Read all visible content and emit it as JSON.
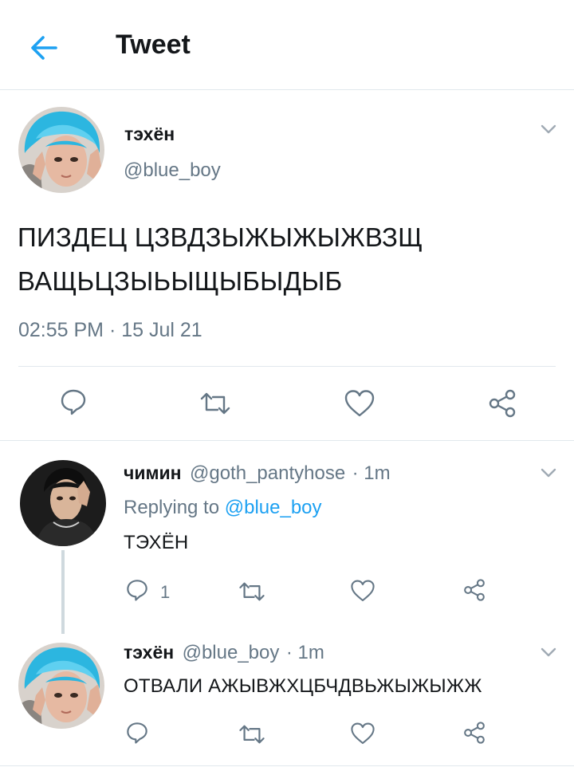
{
  "header": {
    "title": "Tweet"
  },
  "main_tweet": {
    "name": "тэхён",
    "handle": "@blue_boy",
    "text_line1": "ПИЗДЕЦ ЦЗВДЗЫЖЫЖЫЖВЗЩ",
    "text_line2": "ВАЩЬЦЗЫЬЫЩЫБЫДЫБ",
    "timestamp": "02:55 PM · 15 Jul 21"
  },
  "replies": [
    {
      "name": "чимин",
      "handle": "@goth_pantyhose",
      "time": "· 1m",
      "replying_prefix": "Replying to",
      "replying_to": "@blue_boy",
      "text": "ТЭХЁН",
      "reply_count": "1"
    },
    {
      "name": "тэхён",
      "handle": "@blue_boy",
      "time": "· 1m",
      "text": "ОТВАЛИ АЖЫВЖХЦБЧДВЬЖЫЖЫЖЖ"
    }
  ],
  "colors": {
    "accent": "#1da1f2",
    "muted": "#657786",
    "divider": "#e1e8ed"
  }
}
